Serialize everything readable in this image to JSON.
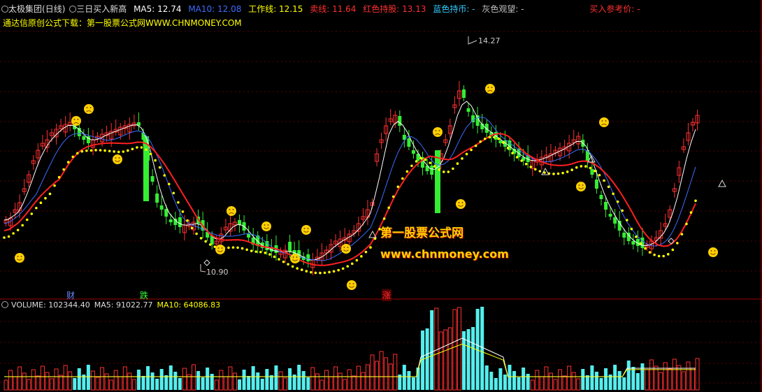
{
  "header": {
    "stock_name": "太极集团",
    "period": "(日线)",
    "indicator_name": "三日买入新高",
    "ma5_label": "MA5: 12.74",
    "ma10_label": "MA10: 12.08",
    "work_line_label": "工作线: 12.15",
    "sell_line_label": "卖线: 11.64",
    "red_hold_label": "红色持股: 13.13",
    "blue_hold_label": "蓝色持币: -",
    "gray_watch_label": "灰色观望: -",
    "buy_ref_label": "买入参考价: -",
    "colors": {
      "ma5": "#ffffff",
      "ma10": "#3b6cff",
      "work": "#ffff00",
      "sell": "#ff3030",
      "red": "#ff3030",
      "blue": "#33ccff",
      "gray": "#c0c0c0"
    }
  },
  "subheader": {
    "text": "通达信原创公式下载：第一股票公式网WWW.CHNMONEY.COM"
  },
  "volume_header": {
    "volume_label": "VOLUME: 102344.40",
    "ma5_label": "MA5: 91022.77",
    "ma10_label": "MA10: 64086.83"
  },
  "chart_tags": {
    "cai": "财",
    "die": "跌",
    "zhang": "涨",
    "high_price": "14.27",
    "low_price": "10.90"
  },
  "watermark": {
    "line1": "第一股票公式网",
    "line2": "www.chnmoney.com"
  },
  "chart_data": {
    "type": "candlestick",
    "price_range": [
      10.5,
      14.5
    ],
    "marked_high": 14.27,
    "marked_low": 10.9,
    "volume_series": [
      "VOLUME",
      "MA5",
      "MA10"
    ],
    "overlays": [
      "MA5",
      "MA10",
      "工作线",
      "卖线"
    ]
  },
  "icons": {
    "settings": "gear-icon",
    "face": "smiley-icon",
    "sad": "sad-face-icon",
    "triangle": "triangle-signal-icon",
    "diamond": "diamond-signal-icon"
  }
}
